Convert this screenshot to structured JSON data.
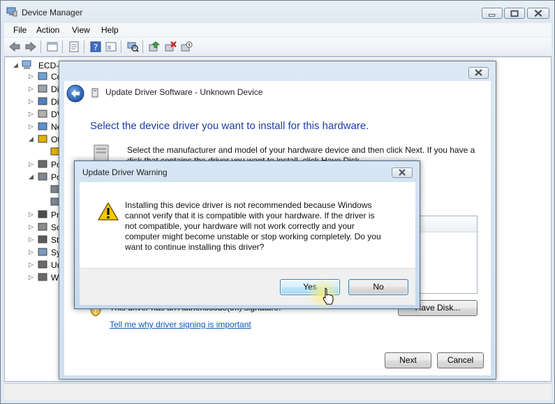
{
  "main_window": {
    "title": "Device Manager",
    "menu": [
      "File",
      "Action",
      "View",
      "Help"
    ],
    "tree": {
      "root": "ECD-T",
      "items": [
        "Co",
        "Di",
        "Di",
        "DV",
        "Ne",
        "Ot",
        "",
        "Po",
        "Po",
        "",
        "",
        "Pr",
        "So",
        "St",
        "Sy",
        "Un",
        "W"
      ]
    }
  },
  "wizard": {
    "title": "Update Driver Software - Unknown Device",
    "heading": "Select the device driver you want to install for this hardware.",
    "description": "Select the manufacturer and model of your hardware device and then click Next. If you have a disk that contains the driver you want to install, click Have Disk.",
    "signature_text": "This driver has an Authenticode(tm) signature.",
    "signature_link": "Tell me why driver signing is important",
    "have_disk_label": "Have Disk...",
    "next_label": "Next",
    "cancel_label": "Cancel"
  },
  "warning_dialog": {
    "title": "Update Driver Warning",
    "message": "Installing this device driver is not recommended because Windows\ncannot verify that it is compatible with your hardware.  If the driver is\nnot compatible, your hardware will not work correctly and your\ncomputer might become unstable or stop working completely.  Do you\nwant to continue installing this driver?",
    "yes_label": "Yes",
    "no_label": "No"
  },
  "colors": {
    "heading_blue": "#1d3ea3",
    "link_blue": "#0b58b8",
    "window_frame": "#dfe8f2"
  },
  "icons": [
    "back-arrow-icon",
    "forward-arrow-icon",
    "warning-icon",
    "shield-icon",
    "computer-icon",
    "cursor-icon"
  ]
}
